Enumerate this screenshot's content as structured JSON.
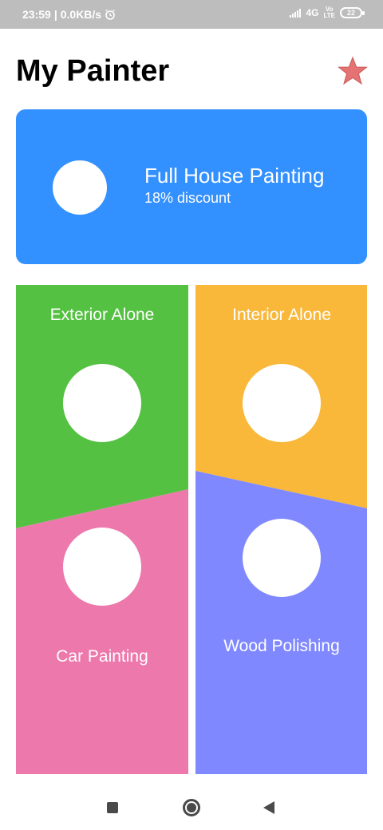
{
  "status_bar": {
    "time": "23:59",
    "speed": "0.0KB/s",
    "network": "4G",
    "volte_top": "Vo",
    "volte_bottom": "LTE",
    "battery": "22",
    "alarm_icon": "alarm-clock-icon"
  },
  "app": {
    "title": "My Painter",
    "favorite_icon": "star-icon"
  },
  "featured": {
    "title": "Full House Painting",
    "subtitle": "18% discount",
    "color": "#3390ff"
  },
  "tiles": [
    {
      "label": "Exterior Alone",
      "color": "#55c142"
    },
    {
      "label": "Interior Alone",
      "color": "#f9b83a"
    },
    {
      "label": "Car Painting",
      "color": "#ec78ac"
    },
    {
      "label": "Wood Polishing",
      "color": "#7f88fe"
    }
  ],
  "colors": {
    "star": "#e57373",
    "background": "#ffffff"
  }
}
